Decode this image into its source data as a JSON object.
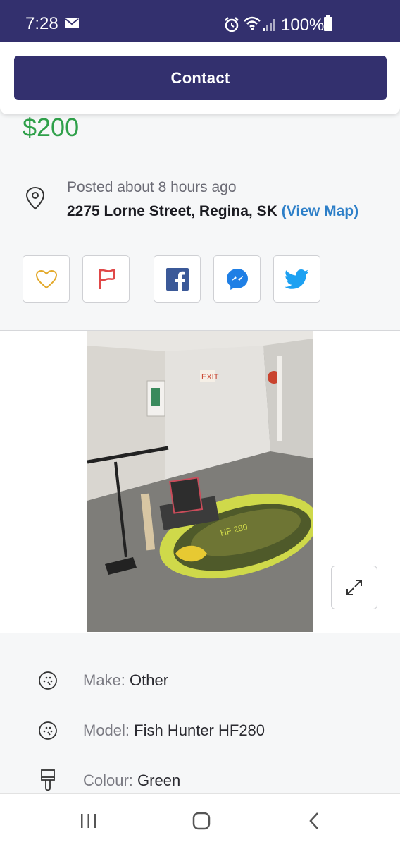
{
  "status_bar": {
    "time": "7:28",
    "battery": "100%",
    "icons": [
      "mail-icon",
      "alarm-icon",
      "wifi-icon",
      "signal-icon",
      "battery-icon"
    ]
  },
  "contact": {
    "label": "Contact"
  },
  "listing": {
    "price": "$200",
    "posted": "Posted about 8 hours ago",
    "address": "2275 Lorne Street, Regina, SK",
    "view_map": "(View Map)"
  },
  "share_buttons": [
    "heart-icon",
    "flag-icon",
    "facebook-icon",
    "messenger-icon",
    "twitter-icon"
  ],
  "attributes": [
    {
      "label": "Make:",
      "value": "Other",
      "icon": "speedometer-icon"
    },
    {
      "label": "Model:",
      "value": "Fish Hunter HF280",
      "icon": "speedometer-icon"
    },
    {
      "label": "Colour:",
      "value": "Green",
      "icon": "paintbrush-icon"
    }
  ],
  "colors": {
    "brand": "#33306e",
    "price": "#2fa04a",
    "link": "#2d7fc8",
    "heart": "#e3a92b",
    "flag": "#e04848",
    "facebook": "#3b5998",
    "messenger": "#1f7fe5",
    "twitter": "#1da1f2"
  }
}
